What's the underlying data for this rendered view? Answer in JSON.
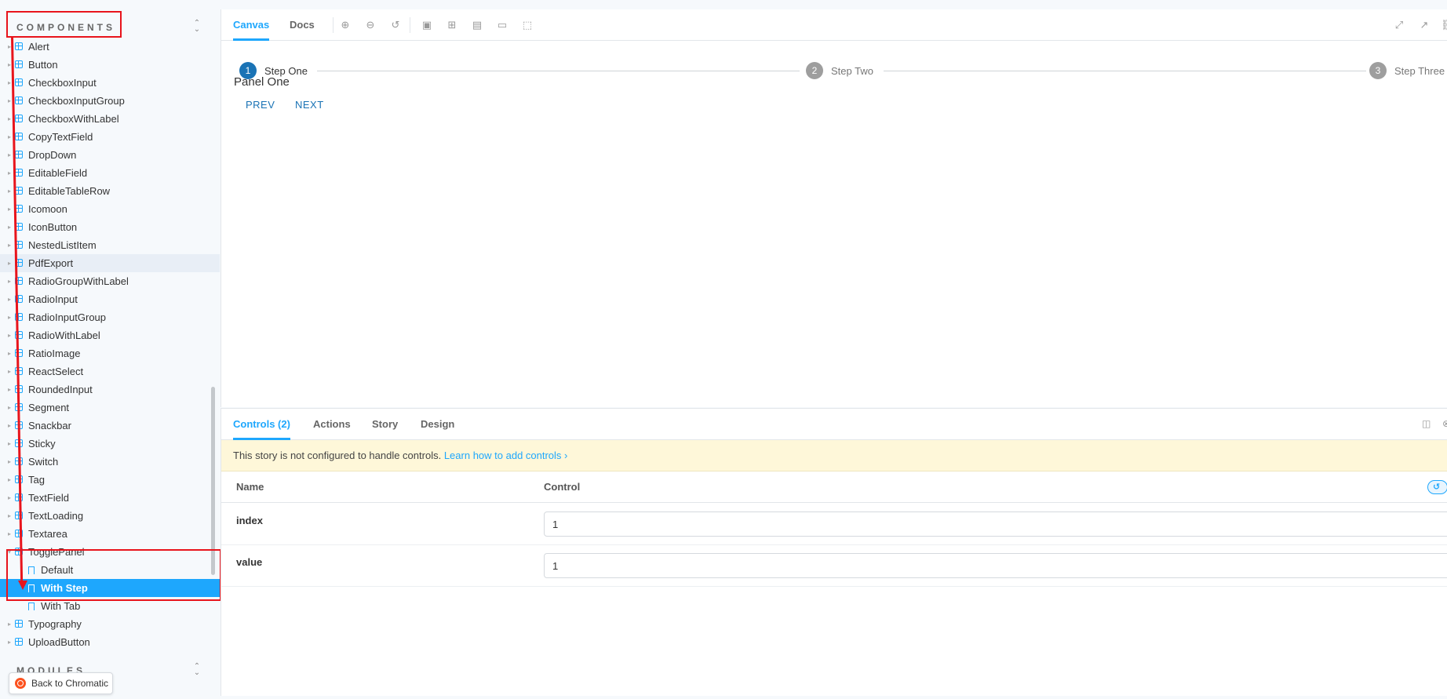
{
  "sidebar": {
    "section_title": "COMPONENTS",
    "items": [
      {
        "label": "Alert"
      },
      {
        "label": "Button"
      },
      {
        "label": "CheckboxInput"
      },
      {
        "label": "CheckboxInputGroup"
      },
      {
        "label": "CheckboxWithLabel"
      },
      {
        "label": "CopyTextField"
      },
      {
        "label": "DropDown"
      },
      {
        "label": "EditableField"
      },
      {
        "label": "EditableTableRow"
      },
      {
        "label": "Icomoon"
      },
      {
        "label": "IconButton"
      },
      {
        "label": "NestedListItem"
      },
      {
        "label": "PdfExport"
      },
      {
        "label": "RadioGroupWithLabel"
      },
      {
        "label": "RadioInput"
      },
      {
        "label": "RadioInputGroup"
      },
      {
        "label": "RadioWithLabel"
      },
      {
        "label": "RatioImage"
      },
      {
        "label": "ReactSelect"
      },
      {
        "label": "RoundedInput"
      },
      {
        "label": "Segment"
      },
      {
        "label": "Snackbar"
      },
      {
        "label": "Sticky"
      },
      {
        "label": "Switch"
      },
      {
        "label": "Tag"
      },
      {
        "label": "TextField"
      },
      {
        "label": "TextLoading"
      },
      {
        "label": "Textarea"
      },
      {
        "label": "TogglePanel"
      }
    ],
    "toggle_children": [
      {
        "label": "Default"
      },
      {
        "label": "With Step"
      },
      {
        "label": "With Tab"
      }
    ],
    "after_items": [
      {
        "label": "Typography"
      },
      {
        "label": "UploadButton"
      }
    ],
    "modules_title": "MODULES",
    "back_button": "Back to Chromatic"
  },
  "toolbar": {
    "tabs": [
      "Canvas",
      "Docs"
    ]
  },
  "stepper": {
    "steps": [
      {
        "num": "1",
        "label": "Step One"
      },
      {
        "num": "2",
        "label": "Step Two"
      },
      {
        "num": "3",
        "label": "Step Three"
      }
    ],
    "panel_title": "Panel One",
    "prev_label": "PREV",
    "next_label": "NEXT"
  },
  "addons": {
    "tabs": [
      "Controls (2)",
      "Actions",
      "Story",
      "Design"
    ],
    "notice_text": "This story is not configured to handle controls.",
    "notice_link": "Learn how to add controls",
    "col_name": "Name",
    "col_control": "Control",
    "rows": [
      {
        "name": "index",
        "value": "1"
      },
      {
        "name": "value",
        "value": "1"
      }
    ]
  },
  "colors": {
    "accent": "#1ea7fd",
    "annotation": "#e8141c",
    "step_active": "#1a73b5",
    "step_inactive": "#9e9e9e"
  }
}
